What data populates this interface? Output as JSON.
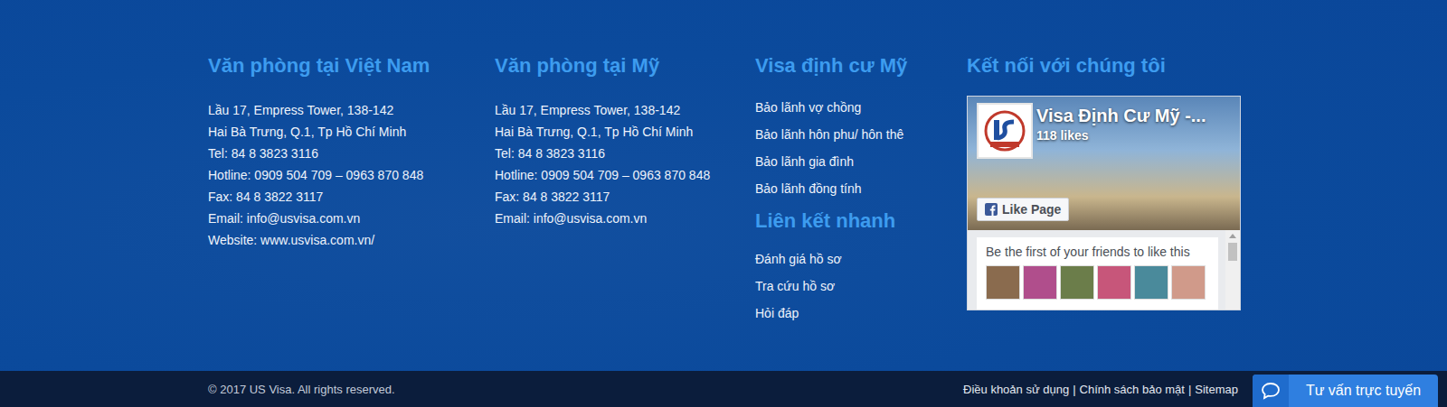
{
  "offices": [
    {
      "title": "Văn phòng tại Việt Nam",
      "lines": [
        "Lầu 17, Empress Tower, 138-142",
        "Hai Bà Trưng, Q.1, Tp Hồ Chí Minh",
        "Tel: 84 8 3823 3116",
        "Hotline: 0909 504 709 – 0963 870 848",
        "Fax: 84 8 3822 3117",
        "Email: info@usvisa.com.vn",
        "Website: www.usvisa.com.vn/"
      ]
    },
    {
      "title": "Văn phòng tại Mỹ",
      "lines": [
        "Lầu 17, Empress Tower, 138-142",
        "Hai Bà Trưng, Q.1, Tp Hồ Chí Minh",
        "Tel: 84 8 3823 3116",
        "Hotline: 0909 504 709 – 0963 870 848",
        "Fax: 84 8 3822 3117",
        "Email: info@usvisa.com.vn"
      ]
    }
  ],
  "visa_links": {
    "title": "Visa định cư Mỹ",
    "items": [
      "Bảo lãnh vợ chồng",
      "Bảo lãnh hôn phu/ hôn thê",
      "Bảo lãnh gia đình",
      "Bảo lãnh đồng tính"
    ]
  },
  "quick_links": {
    "title": "Liên kết nhanh",
    "items": [
      "Đánh giá hồ sơ",
      "Tra cứu hồ sơ",
      "Hỏi đáp"
    ]
  },
  "social": {
    "title": "Kết nối với chúng tôi",
    "page_name": "Visa Định Cư Mỹ -...",
    "likes": "118 likes",
    "like_button": "Like Page",
    "friends_text": "Be the first of your friends to like this"
  },
  "footer": {
    "copyright": "© 2017 US Visa. All rights reserved.",
    "links": [
      "Điều khoản sử dụng",
      "Chính sách bảo mật",
      "Sitemap"
    ],
    "separator": "|"
  },
  "chat": {
    "label": "Tư vấn trực tuyến"
  }
}
